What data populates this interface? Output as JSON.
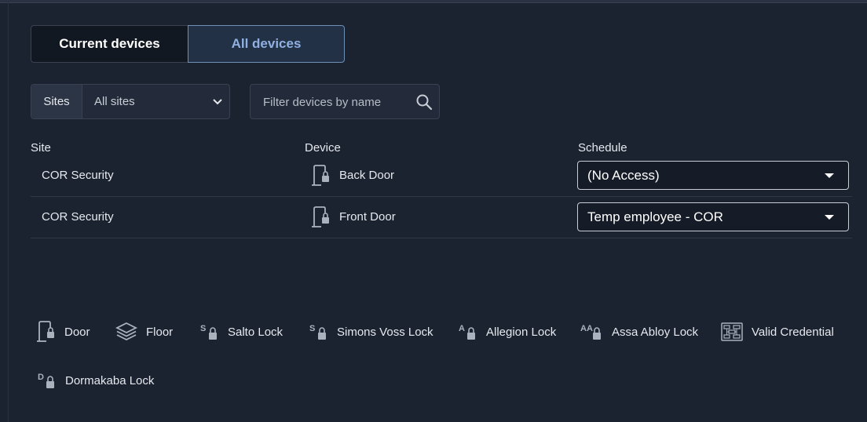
{
  "tabs": {
    "current_label": "Current devices",
    "all_label": "All devices"
  },
  "sites_filter": {
    "label": "Sites",
    "value": "All sites"
  },
  "search": {
    "placeholder": "Filter devices by name"
  },
  "table": {
    "headers": {
      "site": "Site",
      "device": "Device",
      "schedule": "Schedule"
    },
    "rows": [
      {
        "site": "COR Security",
        "device": "Back Door",
        "device_icon": "door-lock-icon",
        "schedule": "(No Access)"
      },
      {
        "site": "COR Security",
        "device": "Front Door",
        "device_icon": "door-lock-icon",
        "schedule": "Temp employee - COR"
      }
    ]
  },
  "legend": {
    "items": [
      {
        "icon": "door-icon",
        "label": "Door"
      },
      {
        "icon": "floor-icon",
        "label": "Floor"
      },
      {
        "icon": "salto-lock-icon",
        "prefix": "S",
        "label": "Salto Lock"
      },
      {
        "icon": "simons-voss-lock-icon",
        "prefix": "S",
        "label": "Simons Voss Lock"
      },
      {
        "icon": "allegion-lock-icon",
        "prefix": "A",
        "label": "Allegion Lock"
      },
      {
        "icon": "assa-abloy-lock-icon",
        "prefix": "AA",
        "label": "Assa Abloy Lock"
      },
      {
        "icon": "valid-credential-icon",
        "label": "Valid Credential"
      },
      {
        "icon": "dormakaba-lock-icon",
        "prefix": "D",
        "label": "Dormakaba Lock"
      }
    ]
  },
  "colors": {
    "background": "#1b2230",
    "active_tab_bg": "#233146",
    "active_tab_text": "#8fb0e0",
    "icon": "#aab2be"
  }
}
